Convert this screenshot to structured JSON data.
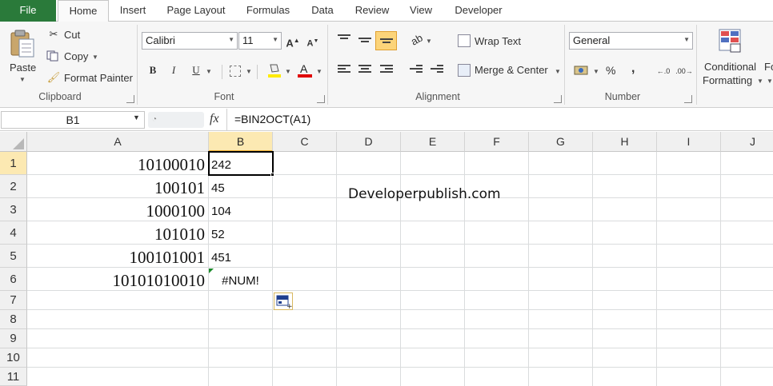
{
  "tabs": {
    "file": "File",
    "items": [
      "Home",
      "Insert",
      "Page Layout",
      "Formulas",
      "Data",
      "Review",
      "View",
      "Developer"
    ]
  },
  "ribbon": {
    "clipboard": {
      "paste": "Paste",
      "cut": "Cut",
      "copy": "Copy",
      "format_painter": "Format Painter",
      "label": "Clipboard"
    },
    "font": {
      "name": "Calibri",
      "size": "11",
      "label": "Font",
      "bold": "B",
      "italic": "I",
      "underline": "U"
    },
    "alignment": {
      "wrap_text": "Wrap Text",
      "merge_center": "Merge & Center",
      "label": "Alignment"
    },
    "number": {
      "format": "General",
      "percent": "%",
      "comma": ",",
      "label": "Number"
    },
    "styles": {
      "conditional": "Conditional",
      "formatting": "Formatting",
      "next_partial": "Fo"
    }
  },
  "formula_bar": {
    "name_box": "B1",
    "fx": "fx",
    "formula": "=BIN2OCT(A1)"
  },
  "sheet": {
    "columns": [
      "A",
      "B",
      "C",
      "D",
      "E",
      "F",
      "G",
      "H",
      "I",
      "J"
    ],
    "rows": [
      "1",
      "2",
      "3",
      "4",
      "5",
      "6",
      "7",
      "8",
      "9",
      "10",
      "11"
    ],
    "col_a": [
      "10100010",
      "100101",
      "1000100",
      "101010",
      "100101001",
      "10101010010"
    ],
    "col_b": [
      "242",
      "45",
      "104",
      "52",
      "451",
      "#NUM!"
    ],
    "watermark": "Developerpublish.com"
  },
  "colors": {
    "file_tab": "#2a7a3a",
    "selected_header": "#fce9b2",
    "selection_border": "#000000"
  }
}
